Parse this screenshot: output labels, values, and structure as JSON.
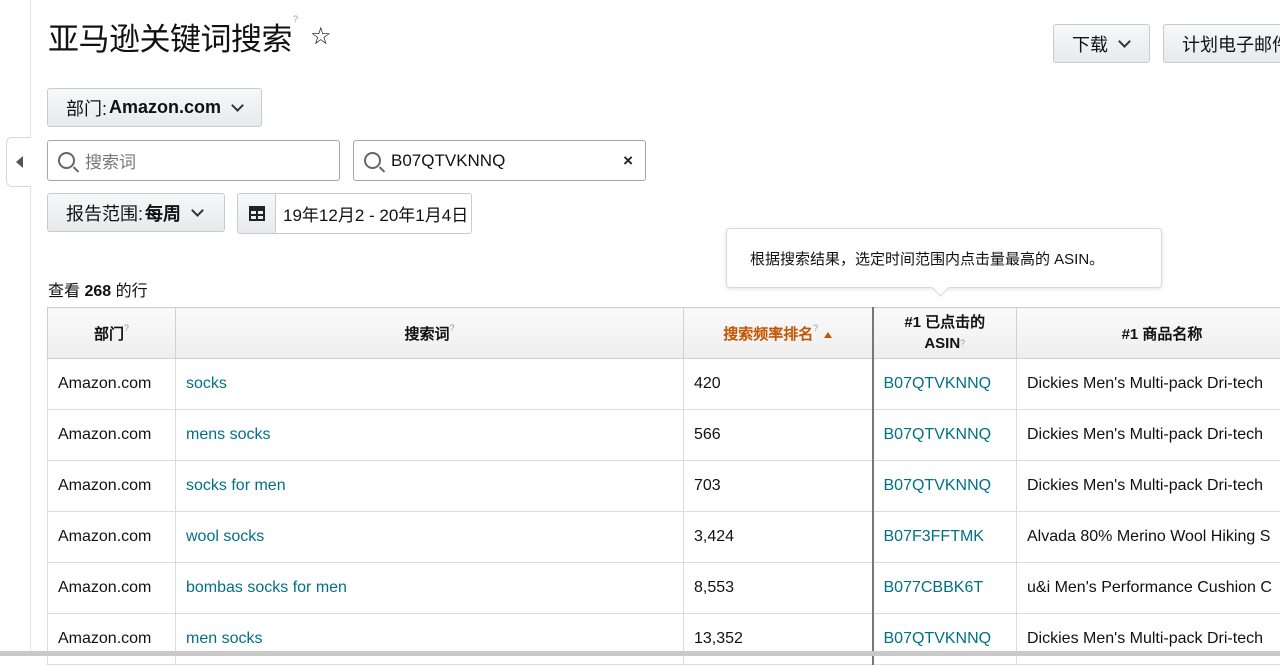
{
  "header": {
    "title": "亚马逊关键词搜索",
    "title_help": "?",
    "star_icon": "☆",
    "download_label": "下载",
    "email_label": "计划电子邮件"
  },
  "filters": {
    "dept_prefix": "部门:",
    "dept_value": "Amazon.com",
    "search_placeholder": "搜索词",
    "asin_value": "B07QTVKNNQ",
    "clear_icon": "×",
    "range_prefix": "报告范围:",
    "range_value": "每周",
    "date_value": "19年12月2 - 20年1月4日"
  },
  "tooltip": {
    "text": "根据搜索结果，选定时间范围内点击量最高的 ASIN。"
  },
  "rows_summary": {
    "prefix": "查看",
    "count": "268",
    "suffix": "的行"
  },
  "table": {
    "headers": {
      "dept": "部门",
      "term": "搜索词",
      "rank": "搜索频率排名",
      "asin_line1": "#1 已点击的",
      "asin_line2": "ASIN",
      "product": "#1 商品名称",
      "help": "?"
    },
    "rows": [
      {
        "dept": "Amazon.com",
        "term": "socks",
        "rank": "420",
        "asin": "B07QTVKNNQ",
        "product": "Dickies Men's Multi-pack Dri-tech"
      },
      {
        "dept": "Amazon.com",
        "term": "mens socks",
        "rank": "566",
        "asin": "B07QTVKNNQ",
        "product": "Dickies Men's Multi-pack Dri-tech"
      },
      {
        "dept": "Amazon.com",
        "term": "socks for men",
        "rank": "703",
        "asin": "B07QTVKNNQ",
        "product": "Dickies Men's Multi-pack Dri-tech"
      },
      {
        "dept": "Amazon.com",
        "term": "wool socks",
        "rank": "3,424",
        "asin": "B07F3FFTMK",
        "product": "Alvada 80% Merino Wool Hiking S"
      },
      {
        "dept": "Amazon.com",
        "term": "bombas socks for men",
        "rank": "8,553",
        "asin": "B077CBBK6T",
        "product": "u&i Men's Performance Cushion C"
      },
      {
        "dept": "Amazon.com",
        "term": "men socks",
        "rank": "13,352",
        "asin": "B07QTVKNNQ",
        "product": "Dickies Men's Multi-pack Dri-tech"
      }
    ]
  },
  "colors": {
    "link": "#007185",
    "sorted_header": "#c45500"
  }
}
